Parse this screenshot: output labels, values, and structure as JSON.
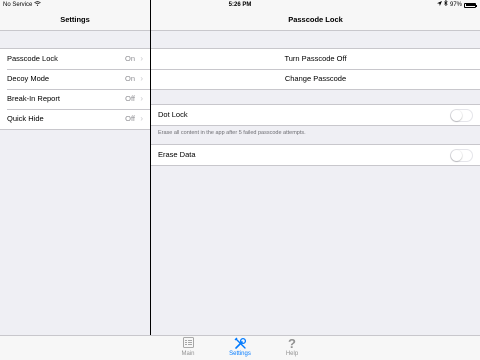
{
  "status": {
    "carrier": "No Service",
    "time": "5:26 PM",
    "battery": "97%"
  },
  "master": {
    "title": "Settings",
    "items": [
      {
        "label": "Passcode Lock",
        "value": "On"
      },
      {
        "label": "Decoy Mode",
        "value": "On"
      },
      {
        "label": "Break-In Report",
        "value": "Off"
      },
      {
        "label": "Quick Hide",
        "value": "Off"
      }
    ]
  },
  "detail": {
    "title": "Passcode Lock",
    "actions": [
      {
        "label": "Turn Passcode Off"
      },
      {
        "label": "Change Passcode"
      }
    ],
    "dot_lock": {
      "label": "Dot Lock",
      "on": false
    },
    "dot_lock_note": "Erase all content in the app after 5 failed passcode attempts.",
    "erase_data": {
      "label": "Erase Data",
      "on": false
    }
  },
  "tabs": [
    {
      "label": "Main",
      "icon": "list-icon",
      "active": false
    },
    {
      "label": "Settings",
      "icon": "tools-icon",
      "active": true
    },
    {
      "label": "Help",
      "icon": "question-icon",
      "active": false
    }
  ],
  "colors": {
    "accent": "#007aff",
    "background": "#efeff4",
    "separator": "#c8c7cc"
  }
}
